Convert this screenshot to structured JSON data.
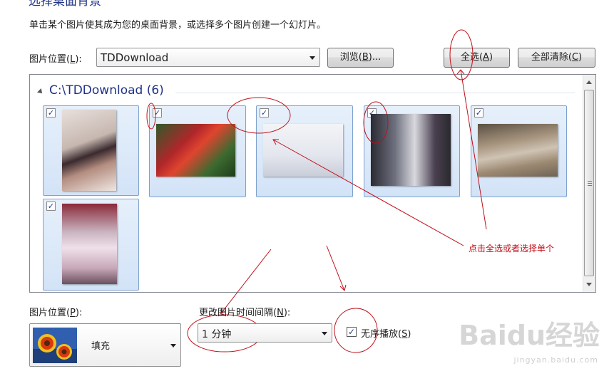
{
  "header": {
    "title": "选择桌面背景",
    "description": "单击某个图片使其成为您的桌面背景，或选择多个图片创建一个幻灯片。"
  },
  "location": {
    "label_prefix": "图片位置(",
    "label_key": "L",
    "label_suffix": "):",
    "value": "TDDownload",
    "browse_prefix": "浏览(",
    "browse_key": "B",
    "browse_suffix": ")...",
    "select_all_prefix": "全选(",
    "select_all_key": "A",
    "select_all_suffix": ")",
    "clear_all_prefix": "全部清除(",
    "clear_all_key": "C",
    "clear_all_suffix": ")"
  },
  "gallery": {
    "group_header": "C:\\TDDownload (6)",
    "images": [
      {
        "checked": true
      },
      {
        "checked": true
      },
      {
        "checked": true
      },
      {
        "checked": true
      },
      {
        "checked": true
      },
      {
        "checked": true
      }
    ]
  },
  "annotation": {
    "note": "点击全选或者选择单个",
    "color": "#c0101a"
  },
  "position": {
    "label_prefix": "图片位置(",
    "label_key": "P",
    "label_suffix": "):",
    "value": "填充"
  },
  "interval": {
    "label_prefix": "更改图片时间间隔(",
    "label_key": "N",
    "label_suffix": "):",
    "value": "1 分钟"
  },
  "shuffle": {
    "checked": true,
    "label_prefix": "无序播放(",
    "label_key": "S",
    "label_suffix": ")"
  },
  "watermark": {
    "logo": "Baidu经验",
    "url": "jingyan.baidu.com"
  },
  "colors": {
    "accent_title": "#1e3287",
    "tile_border": "#7da2ce",
    "annotation": "#c0101a"
  }
}
